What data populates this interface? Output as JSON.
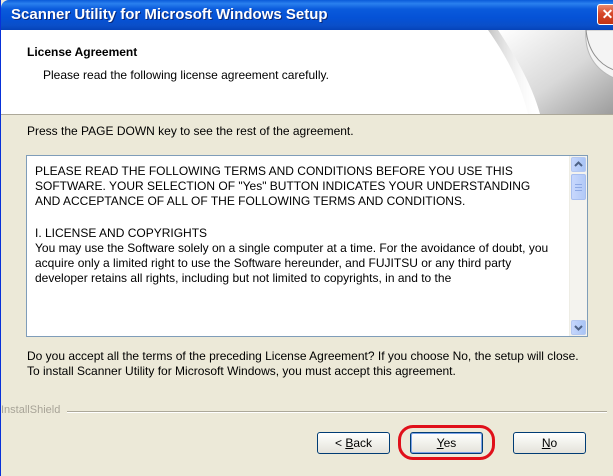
{
  "window": {
    "title": "Scanner Utility for Microsoft Windows Setup",
    "close_glyph": "✕"
  },
  "header": {
    "title": "License Agreement",
    "subtitle": "Please read the following license agreement carefully."
  },
  "instruction": "Press the PAGE DOWN key to see the rest of the agreement.",
  "license": {
    "paragraph1": "PLEASE READ THE FOLLOWING TERMS AND CONDITIONS BEFORE YOU USE THIS SOFTWARE. YOUR SELECTION OF \"Yes\" BUTTON INDICATES YOUR UNDERSTANDING AND ACCEPTANCE OF ALL OF THE FOLLOWING TERMS AND CONDITIONS.",
    "section_title": "I. LICENSE AND COPYRIGHTS",
    "section_body": " You may use the Software solely on a single computer at a time. For the avoidance of doubt, you acquire only a limited right to use the Software hereunder, and FUJITSU or any third party developer retains all rights, including but not limited to copyrights, in and to the"
  },
  "question": "Do you accept all the terms of the preceding License Agreement?  If you choose No,  the setup will close.  To install Scanner Utility for Microsoft Windows, you must accept this agreement.",
  "footer": {
    "brand": "InstallShield"
  },
  "buttons": {
    "back_prefix": "< ",
    "back_key": "B",
    "back_rest": "ack",
    "yes_key": "Y",
    "yes_rest": "es",
    "no_key": "N",
    "no_rest": "o"
  },
  "icons": {
    "scroll_up": "up-arrow",
    "scroll_down": "down-arrow",
    "close": "close-x"
  },
  "colors": {
    "titlebar": "#0a5bdc",
    "highlight": "#e0101a",
    "dialog_bg": "#ece9d8"
  }
}
